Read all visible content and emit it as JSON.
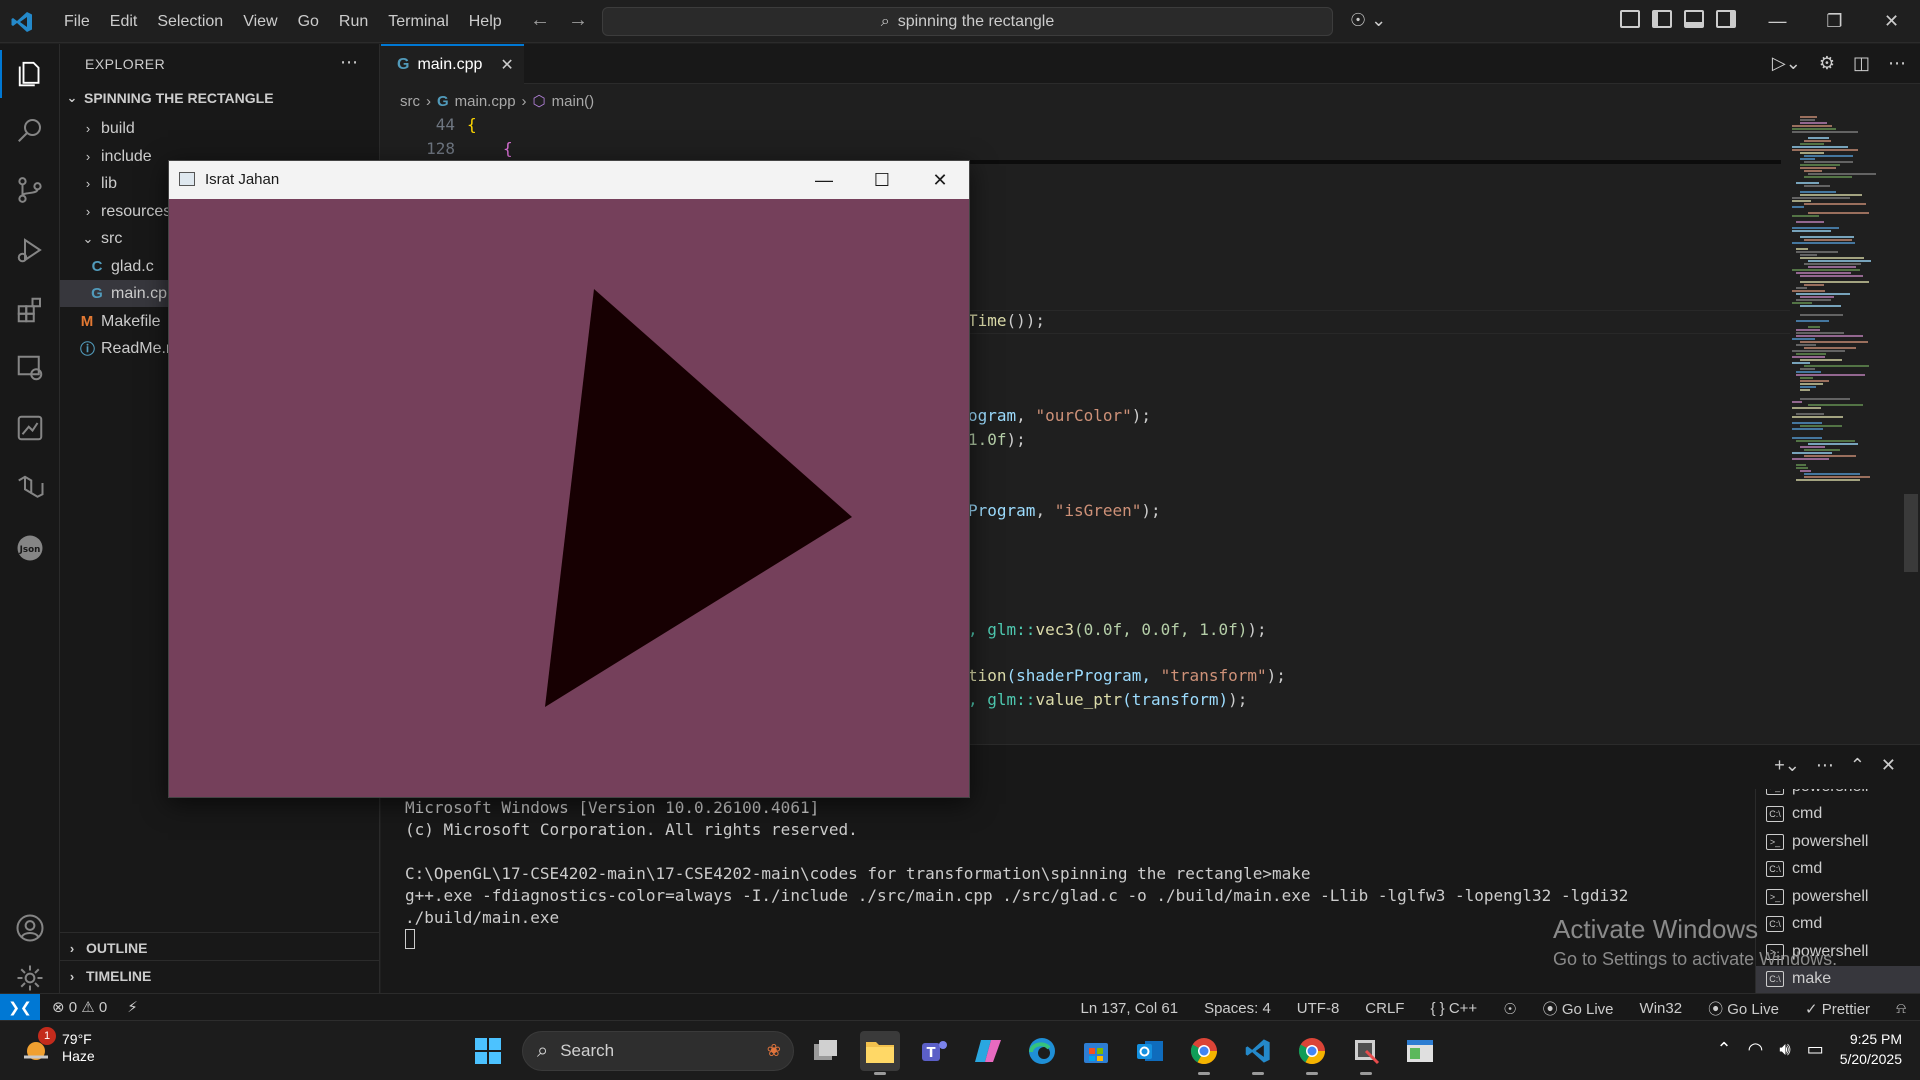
{
  "menu": [
    "File",
    "Edit",
    "Selection",
    "View",
    "Go",
    "Run",
    "Terminal",
    "Help"
  ],
  "command_center": {
    "text": "spinning the rectangle"
  },
  "sidebar": {
    "title": "EXPLORER",
    "project": "SPINNING THE RECTANGLE",
    "items": [
      {
        "label": "build",
        "type": "folder"
      },
      {
        "label": "include",
        "type": "folder"
      },
      {
        "label": "lib",
        "type": "folder"
      },
      {
        "label": "resources",
        "type": "folder"
      },
      {
        "label": "src",
        "type": "folder-open"
      },
      {
        "label": "glad.c",
        "type": "c-file"
      },
      {
        "label": "main.cpp",
        "type": "cpp-file"
      },
      {
        "label": "Makefile",
        "type": "makefile"
      },
      {
        "label": "ReadMe.md",
        "type": "info-file"
      }
    ],
    "outline": "OUTLINE",
    "timeline": "TIMELINE"
  },
  "tab": {
    "label": "main.cpp",
    "close": "✕"
  },
  "breadcrumb": {
    "src": "src",
    "file": "main.cpp",
    "symbol": "main()"
  },
  "sticky_lines": [
    {
      "num": "44",
      "text": "{"
    },
    {
      "num": "128",
      "text": "{"
    }
  ],
  "code_fragments": [
    {
      "pre": "Time",
      "rest": "());"
    },
    {
      "pre": "ogram",
      "mid": ", ",
      "str": "\"ourColor\"",
      "rest": ");"
    },
    {
      "pre": "1.0f",
      "rest": ");"
    },
    {
      "pre": "Program",
      "mid": ", ",
      "str": "\"isGreen\"",
      "rest": ");"
    },
    {
      "pre": ", glm::",
      "fn": "vec3",
      "nums": "(0.0f, 0.0f, 1.0f)",
      "rest": ");"
    },
    {
      "pre": "tion",
      "mid": "(shaderProgram, ",
      "str": "\"transform\"",
      "rest": ");"
    },
    {
      "pre": ", glm::",
      "fn": "value_ptr",
      "mid2": "(transform)",
      "rest": ");"
    }
  ],
  "terminal": {
    "lines": [
      "Microsoft Windows [Version 10.0.26100.4061]",
      "(c) Microsoft Corporation. All rights reserved.",
      "",
      "C:\\OpenGL\\17-CSE4202-main\\17-CSE4202-main\\codes for transformation\\spinning the rectangle>make",
      "g++.exe -fdiagnostics-color=always -I./include ./src/main.cpp ./src/glad.c -o ./build/main.exe -Llib -lglfw3 -lopengl32 -lgdi32",
      "./build/main.exe"
    ],
    "sessions": [
      {
        "label": "powershell",
        "type": "ps"
      },
      {
        "label": "cmd",
        "type": "cmd"
      },
      {
        "label": "powershell",
        "type": "ps"
      },
      {
        "label": "cmd",
        "type": "cmd"
      },
      {
        "label": "powershell",
        "type": "ps"
      },
      {
        "label": "cmd",
        "type": "cmd"
      },
      {
        "label": "powershell",
        "type": "ps"
      },
      {
        "label": "make",
        "type": "cmd"
      }
    ]
  },
  "activate_windows": {
    "title": "Activate Windows",
    "subtitle": "Go to Settings to activate Windows."
  },
  "statusbar": {
    "errors": "0",
    "warnings": "0",
    "position": "Ln 137, Col 61",
    "spaces": "Spaces: 4",
    "encoding": "UTF-8",
    "eol": "CRLF",
    "language": "{ } C++",
    "golive1": "Go Live",
    "platform": "Win32",
    "golive2": "Go Live",
    "prettier": "Prettier"
  },
  "glfw_window": {
    "title": "Israt Jahan",
    "background": "#75405b",
    "triangle_color": "#170002"
  },
  "taskbar": {
    "weather_temp": "79°F",
    "weather_desc": "Haze",
    "weather_badge": "1",
    "search_placeholder": "Search",
    "time": "9:25 PM",
    "date": "5/20/2025"
  },
  "colors": {
    "accent": "#0078d4",
    "editor_bg": "#1f1f1f",
    "sidebar_bg": "#181818"
  }
}
